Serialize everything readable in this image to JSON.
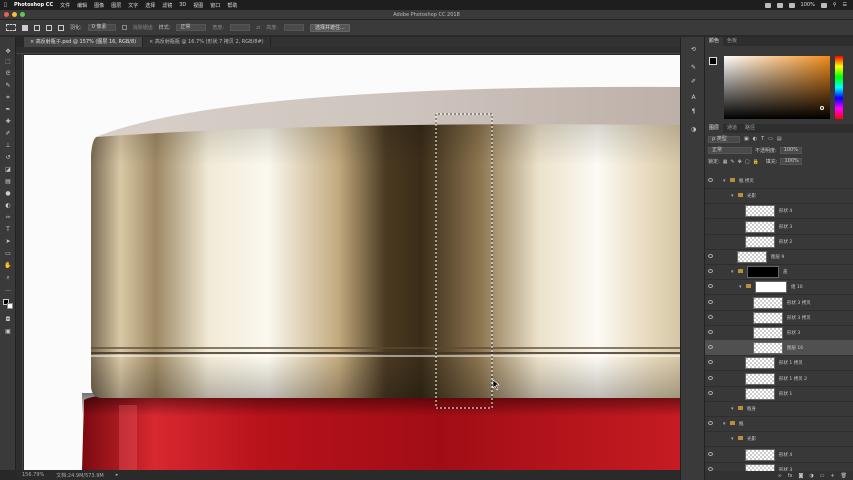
{
  "menubar": {
    "app": "Photoshop CC",
    "items": [
      "文件",
      "编辑",
      "图像",
      "图层",
      "文字",
      "选择",
      "滤镜",
      "3D",
      "视图",
      "窗口",
      "帮助"
    ],
    "battery": "100%",
    "right_icons": [
      "wifi-icon",
      "battery-icon",
      "search-icon",
      "menu-icon"
    ]
  },
  "window": {
    "title": "Adobe Photoshop CC 2018"
  },
  "options": {
    "feather_label": "羽化:",
    "feather_value": "0 像素",
    "antialias": "消除锯齿",
    "style_label": "样式:",
    "style_value": "正常",
    "width_label": "宽度:",
    "height_label": "高度:",
    "select_mask": "选择并遮住..."
  },
  "tabs": [
    {
      "label": "高反射瓶子.psd @ 157% (图层 16, RGB/8)",
      "active": true
    },
    {
      "label": "高反射瓶瓶 @ 16.7% (形状 7 拷贝 2, RGB/8#)",
      "active": false
    }
  ],
  "status": {
    "zoom": "156.79%",
    "doc": "文档:24.9M/573.9M"
  },
  "panels": {
    "color_tabs": [
      "颜色",
      "色板"
    ],
    "layer_tabs": [
      "图层",
      "通道",
      "路径"
    ],
    "filter": "ρ 类型",
    "blend_mode": "正常",
    "opacity_label": "不透明度:",
    "opacity": "100%",
    "lock_label": "锁定:",
    "fill_label": "填充:",
    "fill": "100%"
  },
  "layers": [
    {
      "name": "瓶 拷贝",
      "type": "group",
      "indent": 0,
      "eye": true,
      "sel": false
    },
    {
      "name": "光影",
      "type": "group",
      "indent": 1,
      "eye": false,
      "sel": false
    },
    {
      "name": "形状 4",
      "type": "layer",
      "indent": 2,
      "eye": false,
      "sel": false
    },
    {
      "name": "形状 3",
      "type": "layer",
      "indent": 2,
      "eye": false,
      "sel": false
    },
    {
      "name": "形状 2",
      "type": "layer",
      "indent": 2,
      "eye": false,
      "sel": false
    },
    {
      "name": "图层 9",
      "type": "layer",
      "indent": 1,
      "eye": true,
      "sel": false
    },
    {
      "name": "盖",
      "type": "groupmask",
      "indent": 1,
      "eye": true,
      "sel": false
    },
    {
      "name": "组 10",
      "type": "groupmask2",
      "indent": 2,
      "eye": true,
      "sel": false
    },
    {
      "name": "形状 3 拷贝",
      "type": "layer",
      "indent": 3,
      "eye": true,
      "sel": false
    },
    {
      "name": "形状 3 拷贝",
      "type": "layer",
      "indent": 3,
      "eye": true,
      "sel": false
    },
    {
      "name": "形状 3",
      "type": "layer",
      "indent": 3,
      "eye": true,
      "sel": false
    },
    {
      "name": "图层 16",
      "type": "layer",
      "indent": 3,
      "eye": true,
      "sel": true
    },
    {
      "name": "形状 1 拷贝",
      "type": "layer",
      "indent": 2,
      "eye": true,
      "sel": false
    },
    {
      "name": "形状 1 拷贝 2",
      "type": "layer",
      "indent": 2,
      "eye": true,
      "sel": false
    },
    {
      "name": "形状 1",
      "type": "layer",
      "indent": 2,
      "eye": true,
      "sel": false
    },
    {
      "name": "瓶身",
      "type": "group",
      "indent": 1,
      "eye": false,
      "sel": false
    },
    {
      "name": "瓶",
      "type": "group",
      "indent": 0,
      "eye": true,
      "sel": false
    },
    {
      "name": "光影",
      "type": "group",
      "indent": 1,
      "eye": false,
      "sel": false
    },
    {
      "name": "形状 4",
      "type": "layer",
      "indent": 2,
      "eye": true,
      "sel": false
    },
    {
      "name": "形状 3",
      "type": "layer",
      "indent": 2,
      "eye": true,
      "sel": false
    },
    {
      "name": "形状 2",
      "type": "layer",
      "indent": 2,
      "eye": true,
      "sel": false
    }
  ]
}
